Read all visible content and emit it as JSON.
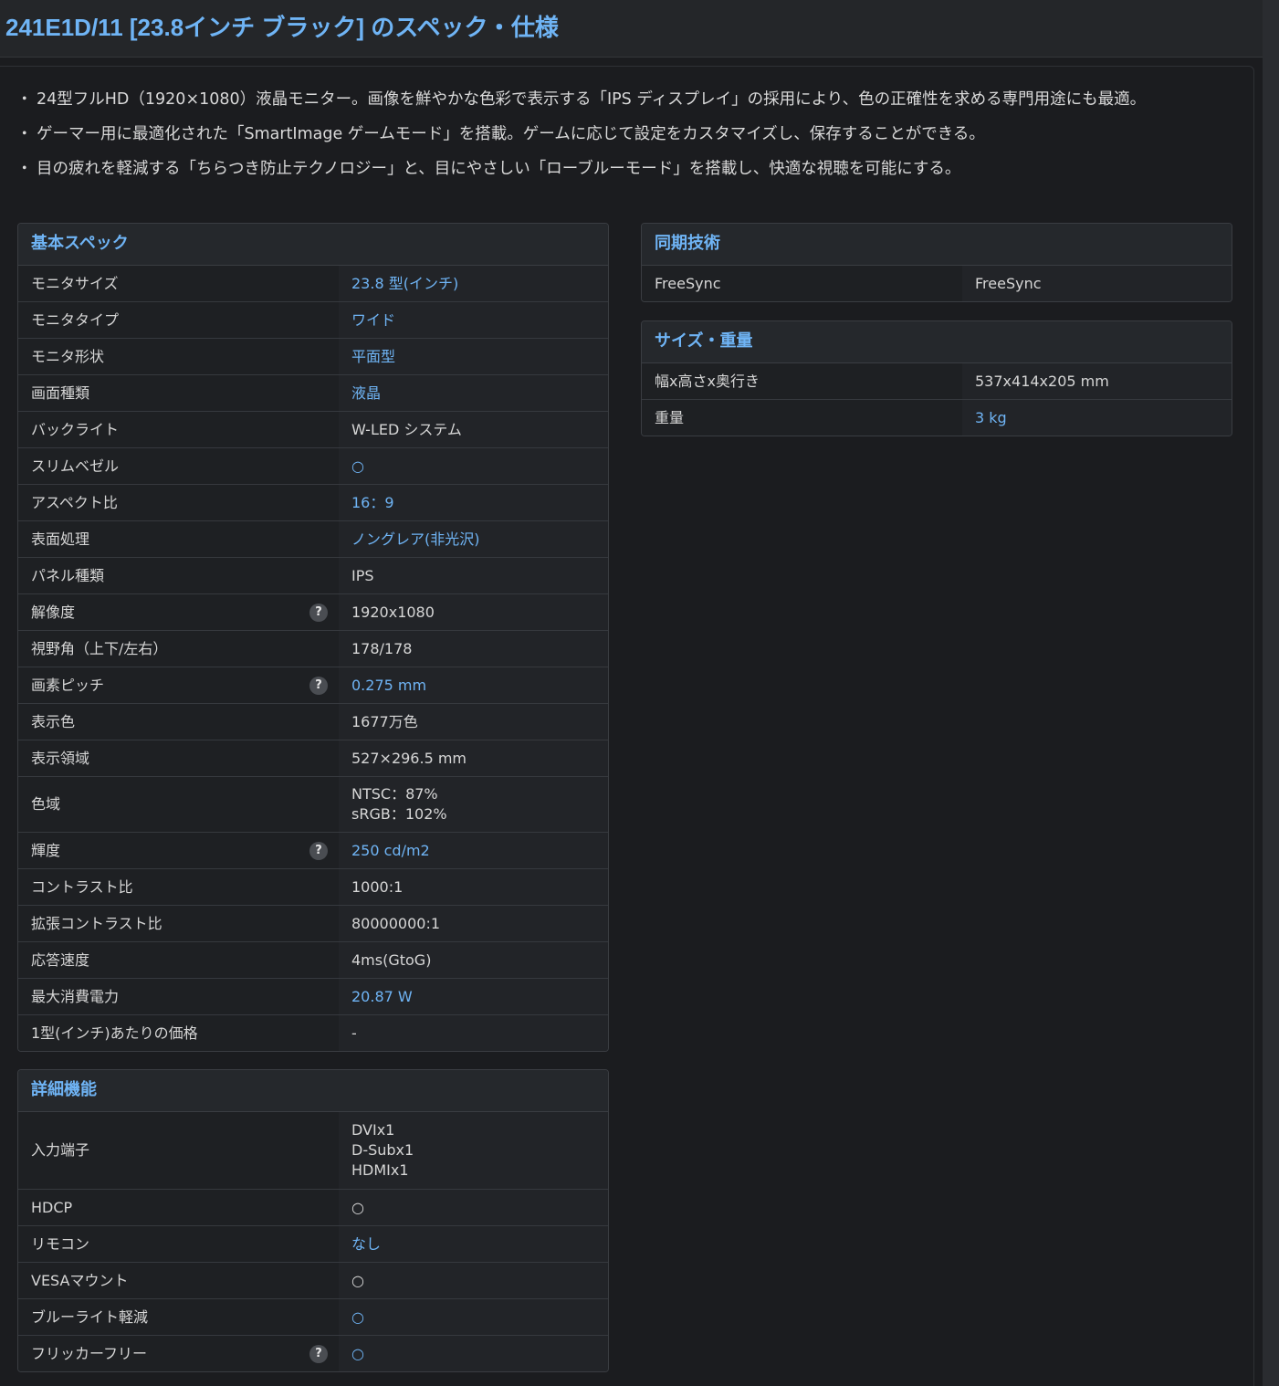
{
  "title": "241E1D/11 [23.8インチ ブラック] のスペック・仕様",
  "bullets": [
    "24型フルHD（1920×1080）液晶モニター。画像を鮮やかな色彩で表示する「IPS ディスプレイ」の採用により、色の正確性を求める専門用途にも最適。",
    "ゲーマー用に最適化された「SmartImage ゲームモード」を搭載。ゲームに応じて設定をカスタマイズし、保存することができる。",
    "目の疲れを軽減する「ちらつき防止テクノロジー」と、目にやさしい「ローブルーモード」を搭載し、快適な視聴を可能にする。"
  ],
  "basic": {
    "heading": "基本スペック",
    "rows": [
      {
        "label": "モニタサイズ",
        "value": "23.8 型(インチ)"
      },
      {
        "label": "モニタタイプ",
        "value": "ワイド"
      },
      {
        "label": "モニタ形状",
        "value": "平面型"
      },
      {
        "label": "画面種類",
        "value": "液晶"
      },
      {
        "label": "バックライト",
        "value": "W-LED システム"
      },
      {
        "label": "スリムベゼル",
        "value": "○"
      },
      {
        "label": "アスペクト比",
        "value": "16：9"
      },
      {
        "label": "表面処理",
        "value": "ノングレア(非光沢)"
      },
      {
        "label": "パネル種類",
        "value": "IPS"
      },
      {
        "label": "解像度",
        "value": "1920x1080"
      },
      {
        "label": "視野角（上下/左右）",
        "value": "178/178"
      },
      {
        "label": "画素ピッチ",
        "value": "0.275 mm"
      },
      {
        "label": "表示色",
        "value": "1677万色"
      },
      {
        "label": "表示領域",
        "value": "527×296.5 mm"
      },
      {
        "label": "色域",
        "value_lines": [
          "NTSC：87%",
          "sRGB：102%"
        ]
      },
      {
        "label": "輝度",
        "value": "250 cd/m2"
      },
      {
        "label": "コントラスト比",
        "value": "1000:1"
      },
      {
        "label": "拡張コントラスト比",
        "value": "80000000:1"
      },
      {
        "label": "応答速度",
        "value": "4ms(GtoG)"
      },
      {
        "label": "最大消費電力",
        "value": "20.87 W"
      },
      {
        "label": "1型(インチ)あたりの価格",
        "value": "-"
      }
    ]
  },
  "detail": {
    "heading": "詳細機能",
    "rows": [
      {
        "label": "入力端子",
        "value_lines": [
          "DVIx1",
          "D-Subx1",
          "HDMIx1"
        ]
      },
      {
        "label": "HDCP",
        "value": "○"
      },
      {
        "label": "リモコン",
        "value": "なし"
      },
      {
        "label": "VESAマウント",
        "value": "○"
      },
      {
        "label": "ブルーライト軽減",
        "value": "○"
      },
      {
        "label": "フリッカーフリー",
        "value": "○"
      }
    ]
  },
  "sync": {
    "heading": "同期技術",
    "rows": [
      {
        "label": "FreeSync",
        "value": "FreeSync"
      }
    ]
  },
  "size": {
    "heading": "サイズ・重量",
    "rows": [
      {
        "label": "幅x高さx奥行き",
        "value": "537x414x205 mm"
      },
      {
        "label": "重量",
        "value": "3 kg"
      }
    ]
  },
  "help_icon_glyph": "?",
  "colors": {
    "accent": "#6fb4f5",
    "background": "#1b1c1f",
    "panel_header": "#25282c"
  }
}
